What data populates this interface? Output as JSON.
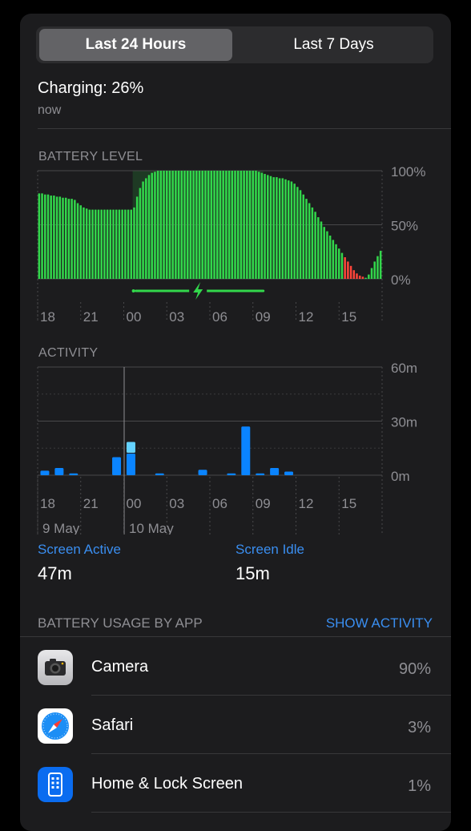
{
  "segmented": {
    "options": [
      "Last 24 Hours",
      "Last 7 Days"
    ],
    "selected": "Last 24 Hours"
  },
  "status": {
    "charging": "Charging: 26%",
    "time": "now"
  },
  "battery_chart": {
    "section_label": "BATTERY LEVEL",
    "y_ticks": [
      "100%",
      "50%",
      "0%"
    ],
    "x_ticks": [
      "18",
      "21",
      "00",
      "03",
      "06",
      "09",
      "12",
      "15"
    ]
  },
  "activity_chart": {
    "section_label": "ACTIVITY",
    "y_ticks": [
      "60m",
      "30m",
      "0m"
    ],
    "x_ticks": [
      "18",
      "21",
      "00",
      "03",
      "06",
      "09",
      "12",
      "15"
    ],
    "date_labels": [
      "9 May",
      "10 May"
    ]
  },
  "chart_data": [
    {
      "type": "bar",
      "title": "BATTERY LEVEL",
      "ylabel": "",
      "ylim": [
        0,
        100
      ],
      "x_ticks": [
        "18",
        "21",
        "00",
        "03",
        "06",
        "09",
        "12",
        "15"
      ],
      "values": [
        79,
        79,
        78,
        78,
        77,
        77,
        76,
        76,
        75,
        75,
        74,
        74,
        73,
        70,
        68,
        66,
        65,
        64,
        64,
        64,
        64,
        64,
        64,
        64,
        64,
        64,
        64,
        64,
        64,
        64,
        64,
        64,
        66,
        76,
        84,
        90,
        93,
        96,
        98,
        99,
        100,
        100,
        100,
        100,
        100,
        100,
        100,
        100,
        100,
        100,
        100,
        100,
        100,
        100,
        100,
        100,
        100,
        100,
        100,
        100,
        100,
        100,
        100,
        100,
        100,
        100,
        100,
        100,
        100,
        100,
        100,
        100,
        100,
        100,
        99,
        98,
        97,
        96,
        95,
        94,
        94,
        93,
        93,
        92,
        91,
        90,
        88,
        85,
        82,
        78,
        74,
        70,
        66,
        62,
        57,
        53,
        48,
        44,
        40,
        36,
        32,
        28,
        24,
        20,
        16,
        12,
        8,
        5,
        3,
        2,
        1,
        4,
        10,
        16,
        21,
        26
      ],
      "red_threshold": 20,
      "charging_ranges": [
        [
          32,
          76
        ]
      ]
    },
    {
      "type": "bar",
      "title": "ACTIVITY",
      "ylabel": "",
      "ylim": [
        0,
        60
      ],
      "x_ticks": [
        "18",
        "21",
        "00",
        "03",
        "06",
        "09",
        "12",
        "15"
      ],
      "series": [
        {
          "values": [
            2.5,
            4,
            1,
            0,
            0,
            10,
            12,
            0,
            1,
            0,
            0,
            3,
            0,
            1,
            27,
            1,
            4,
            2,
            0,
            0,
            0,
            0,
            0,
            0
          ]
        },
        {
          "values": [
            0,
            0,
            0,
            0,
            0,
            0,
            6,
            0,
            0,
            0,
            0,
            0,
            0,
            0,
            0,
            0,
            0,
            0,
            0,
            0,
            0,
            0,
            0,
            0
          ]
        }
      ]
    }
  ],
  "screen": {
    "active_label": "Screen Active",
    "active_value": "47m",
    "idle_label": "Screen Idle",
    "idle_value": "15m"
  },
  "usage": {
    "header": "BATTERY USAGE BY APP",
    "show_activity": "SHOW ACTIVITY",
    "apps": [
      {
        "name": "Camera",
        "percent": "90%",
        "icon": "camera-icon"
      },
      {
        "name": "Safari",
        "percent": "3%",
        "icon": "safari-icon"
      },
      {
        "name": "Home & Lock Screen",
        "percent": "1%",
        "icon": "home-lock-icon"
      }
    ]
  },
  "colors": {
    "green": "#32d74b",
    "red": "#ff453a",
    "blue": "#0a84ff",
    "light_blue": "#64d2ff",
    "link": "#3a8ef0"
  }
}
